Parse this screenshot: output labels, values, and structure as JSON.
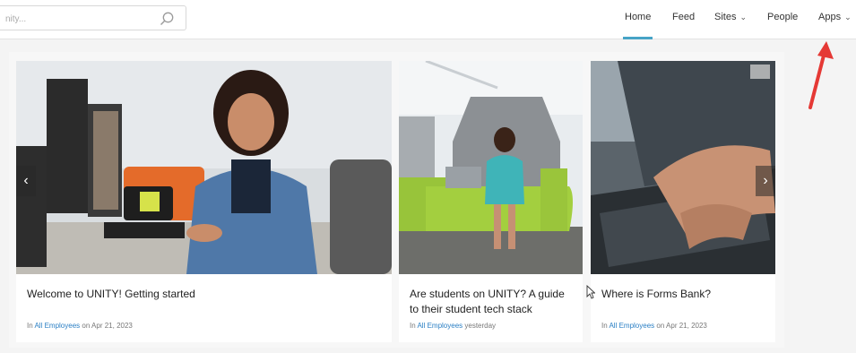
{
  "search": {
    "placeholder": "nity..."
  },
  "nav": {
    "home": "Home",
    "feed": "Feed",
    "sites": "Sites",
    "people": "People",
    "apps": "Apps"
  },
  "colors": {
    "accent": "#46a3c6",
    "link": "#2a7fc4",
    "annotation_arrow": "#e53935"
  },
  "carousel": {
    "cards": [
      {
        "title": "Welcome to UNITY! Getting started",
        "meta_prefix": "In",
        "meta_link": "All Employees",
        "meta_suffix": "on Apr 21, 2023"
      },
      {
        "title": "Are students on UNITY? A guide to their student tech stack",
        "meta_prefix": "In",
        "meta_link": "All Employees",
        "meta_suffix": "yesterday"
      },
      {
        "title": "Where is Forms Bank?",
        "meta_prefix": "In",
        "meta_link": "All Employees",
        "meta_suffix": "on Apr 21, 2023"
      }
    ],
    "prev_icon": "chevron-left-icon",
    "next_icon": "chevron-right-icon"
  }
}
